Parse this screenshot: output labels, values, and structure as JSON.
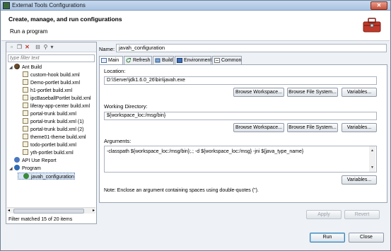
{
  "window": {
    "title": "External Tools Configurations",
    "close_glyph": "✕"
  },
  "header": {
    "title": "Create, manage, and run configurations",
    "subtitle": "Run a program"
  },
  "left": {
    "filter_placeholder": "type filter text",
    "tree": [
      {
        "label": "Ant Build",
        "icon": "ant-icon",
        "level": 0,
        "expanded": true
      },
      {
        "label": "custom-hook build.xml",
        "icon": "xml-file-icon",
        "level": 1
      },
      {
        "label": "Demo-portlet build.xml",
        "icon": "xml-file-icon",
        "level": 1
      },
      {
        "label": "h1-portlet build.xml",
        "icon": "xml-file-icon",
        "level": 1
      },
      {
        "label": "ipcBaseballPortlet build.xml",
        "icon": "xml-file-icon",
        "level": 1
      },
      {
        "label": "liferay-app-center build.xml",
        "icon": "xml-file-icon",
        "level": 1
      },
      {
        "label": "portal-trunk build.xml",
        "icon": "xml-file-icon",
        "level": 1
      },
      {
        "label": "portal-trunk build.xml (1)",
        "icon": "xml-file-icon",
        "level": 1
      },
      {
        "label": "portal-trunk build.xml (2)",
        "icon": "xml-file-icon",
        "level": 1
      },
      {
        "label": "theme01-theme build.xml",
        "icon": "xml-file-icon",
        "level": 1
      },
      {
        "label": "todo-portlet build.xml",
        "icon": "xml-file-icon",
        "level": 1
      },
      {
        "label": "yth-portlet build.xml",
        "icon": "xml-file-icon",
        "level": 1
      },
      {
        "label": "API Use Report",
        "icon": "api-report-icon",
        "level": 0
      },
      {
        "label": "Program",
        "icon": "program-icon",
        "level": 0,
        "expanded": true
      },
      {
        "label": "javah_configuration",
        "icon": "program-config-icon",
        "level": 1,
        "selected": true
      }
    ],
    "status": "Filter matched 15 of 20 items"
  },
  "main": {
    "name_label": "Name:",
    "name_value": "javah_configuration",
    "tabs": [
      {
        "label": "Main",
        "icon": "main-tab-icon"
      },
      {
        "label": "Refresh",
        "icon": "refresh-icon"
      },
      {
        "label": "Build",
        "icon": "build-icon"
      },
      {
        "label": "Environment",
        "icon": "environment-icon"
      },
      {
        "label": "Common",
        "icon": "common-icon"
      }
    ],
    "location_label": "Location:",
    "location_value": "D:\\Server\\jdk1.6.0_26\\bin\\javah.exe",
    "working_dir_label": "Working Directory:",
    "working_dir_value": "${workspace_loc:/msg/bin}",
    "arguments_label": "Arguments:",
    "arguments_value": "-classpath ${workspace_loc:/msg/bin};.; -d ${workspace_loc:/msg} -jni ${java_type_name}",
    "note": "Note: Enclose an argument containing spaces using double-quotes (\").",
    "buttons": {
      "browse_workspace": "Browse Workspace...",
      "browse_file_system": "Browse File System...",
      "variables": "Variables...",
      "apply": "Apply",
      "revert": "Revert",
      "run": "Run",
      "close": "Close"
    }
  }
}
